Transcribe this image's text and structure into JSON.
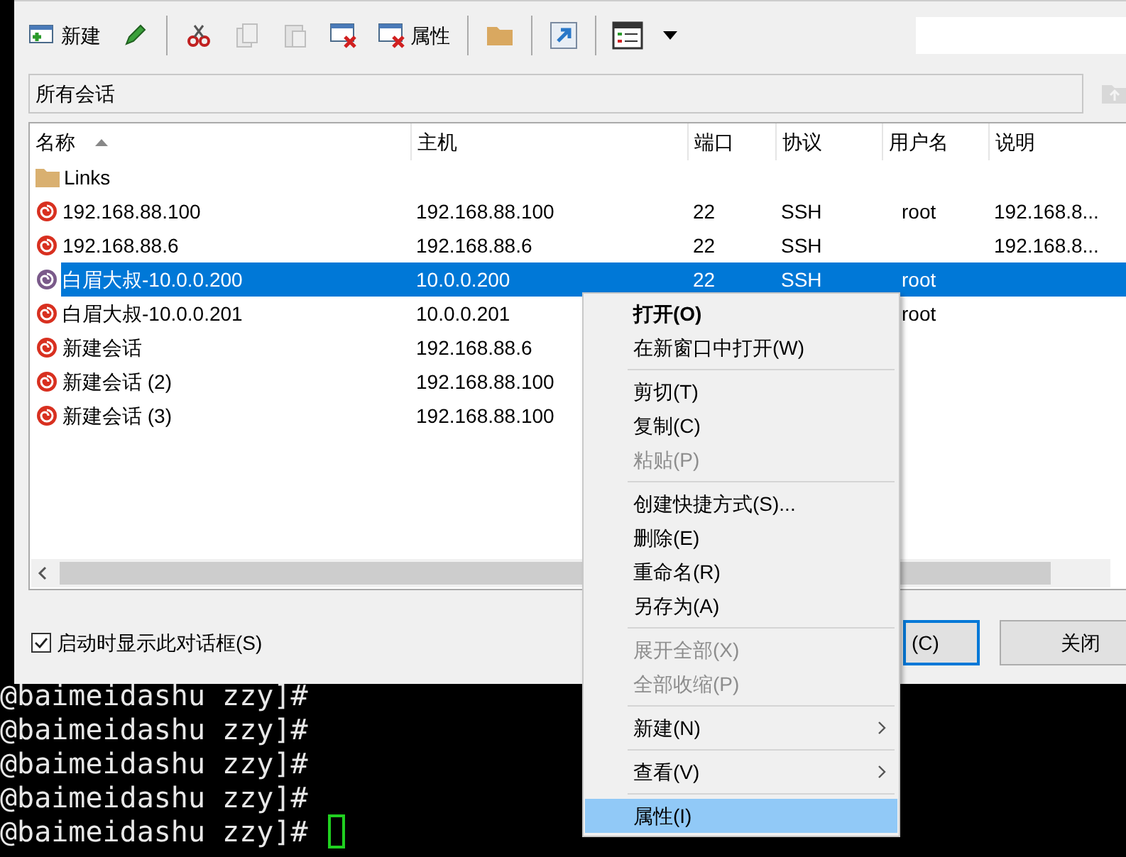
{
  "toolbar": [
    {
      "kind": "button",
      "label": "新建",
      "disabled": false
    },
    {
      "kind": "icon",
      "disabled": false
    },
    {
      "kind": "separator"
    },
    {
      "kind": "icon",
      "disabled": false
    },
    {
      "kind": "icon",
      "disabled": true
    },
    {
      "kind": "icon",
      "disabled": true
    },
    {
      "kind": "icon",
      "disabled": false
    },
    {
      "kind": "button",
      "label": "属性",
      "disabled": false
    },
    {
      "kind": "separator"
    },
    {
      "kind": "icon",
      "disabled": false
    },
    {
      "kind": "separator"
    },
    {
      "kind": "icon",
      "disabled": false
    },
    {
      "kind": "separator"
    },
    {
      "kind": "icon",
      "disabled": false
    },
    {
      "kind": "dropdown",
      "disabled": false
    }
  ],
  "path": {
    "value": "所有会话"
  },
  "table": {
    "columns": [
      {
        "label": "名称",
        "sorted": true
      },
      {
        "label": "主机",
        "sorted": false
      },
      {
        "label": "端口",
        "sorted": false
      },
      {
        "label": "协议",
        "sorted": false
      },
      {
        "label": "用户名",
        "sorted": false
      },
      {
        "label": "说明",
        "sorted": false
      }
    ],
    "rows": [
      {
        "kind": "folder",
        "selected": false,
        "cells": [
          "Links"
        ]
      },
      {
        "kind": "session",
        "selected": false,
        "cells": [
          "192.168.88.100",
          "192.168.88.100",
          "22",
          "SSH",
          "root",
          "192.168.8..."
        ]
      },
      {
        "kind": "session",
        "selected": false,
        "cells": [
          "192.168.88.6",
          "192.168.88.6",
          "22",
          "SSH",
          "",
          "192.168.8..."
        ]
      },
      {
        "kind": "session",
        "selected": true,
        "cells": [
          "白眉大叔-10.0.0.200",
          "10.0.0.200",
          "22",
          "SSH",
          "root",
          ""
        ]
      },
      {
        "kind": "session",
        "selected": false,
        "cells": [
          "白眉大叔-10.0.0.201",
          "10.0.0.201",
          "",
          "",
          "root",
          ""
        ]
      },
      {
        "kind": "session",
        "selected": false,
        "cells": [
          "新建会话",
          "192.168.88.6"
        ]
      },
      {
        "kind": "session",
        "selected": false,
        "cells": [
          "新建会话 (2)",
          "192.168.88.100"
        ]
      },
      {
        "kind": "session",
        "selected": false,
        "cells": [
          "新建会话 (3)",
          "192.168.88.100"
        ]
      }
    ]
  },
  "startup_checkbox": {
    "label": "启动时显示此对话框(S)",
    "checked": true
  },
  "buttons": [
    {
      "label": "(C)",
      "default": true
    },
    {
      "label": "关闭",
      "default": false
    }
  ],
  "terminal": {
    "lines": [
      {
        "text": "@baimeidashu zzy]#",
        "cursor": false
      },
      {
        "text": "@baimeidashu zzy]#",
        "cursor": false
      },
      {
        "text": "@baimeidashu zzy]#",
        "cursor": false
      },
      {
        "text": "@baimeidashu zzy]#",
        "cursor": false
      },
      {
        "text": "@baimeidashu zzy]#",
        "cursor": true
      }
    ]
  },
  "context_menu": {
    "items": [
      {
        "kind": "item",
        "label": "打开(O)",
        "default": true,
        "disabled": false,
        "submenu": false,
        "selected": false
      },
      {
        "kind": "item",
        "label": "在新窗口中打开(W)",
        "default": false,
        "disabled": false,
        "submenu": false,
        "selected": false
      },
      {
        "kind": "separator"
      },
      {
        "kind": "item",
        "label": "剪切(T)",
        "default": false,
        "disabled": false,
        "submenu": false,
        "selected": false
      },
      {
        "kind": "item",
        "label": "复制(C)",
        "default": false,
        "disabled": false,
        "submenu": false,
        "selected": false
      },
      {
        "kind": "item",
        "label": "粘贴(P)",
        "default": false,
        "disabled": true,
        "submenu": false,
        "selected": false
      },
      {
        "kind": "separator"
      },
      {
        "kind": "item",
        "label": "创建快捷方式(S)...",
        "default": false,
        "disabled": false,
        "submenu": false,
        "selected": false
      },
      {
        "kind": "item",
        "label": "删除(E)",
        "default": false,
        "disabled": false,
        "submenu": false,
        "selected": false
      },
      {
        "kind": "item",
        "label": "重命名(R)",
        "default": false,
        "disabled": false,
        "submenu": false,
        "selected": false
      },
      {
        "kind": "item",
        "label": "另存为(A)",
        "default": false,
        "disabled": false,
        "submenu": false,
        "selected": false
      },
      {
        "kind": "separator"
      },
      {
        "kind": "item",
        "label": "展开全部(X)",
        "default": false,
        "disabled": true,
        "submenu": false,
        "selected": false
      },
      {
        "kind": "item",
        "label": "全部收缩(P)",
        "default": false,
        "disabled": true,
        "submenu": false,
        "selected": false
      },
      {
        "kind": "separator"
      },
      {
        "kind": "item",
        "label": "新建(N)",
        "default": false,
        "disabled": false,
        "submenu": true,
        "selected": false
      },
      {
        "kind": "separator"
      },
      {
        "kind": "item",
        "label": "查看(V)",
        "default": false,
        "disabled": false,
        "submenu": true,
        "selected": false
      },
      {
        "kind": "separator"
      },
      {
        "kind": "item",
        "label": "属性(I)",
        "default": false,
        "disabled": false,
        "submenu": false,
        "selected": true
      }
    ]
  }
}
